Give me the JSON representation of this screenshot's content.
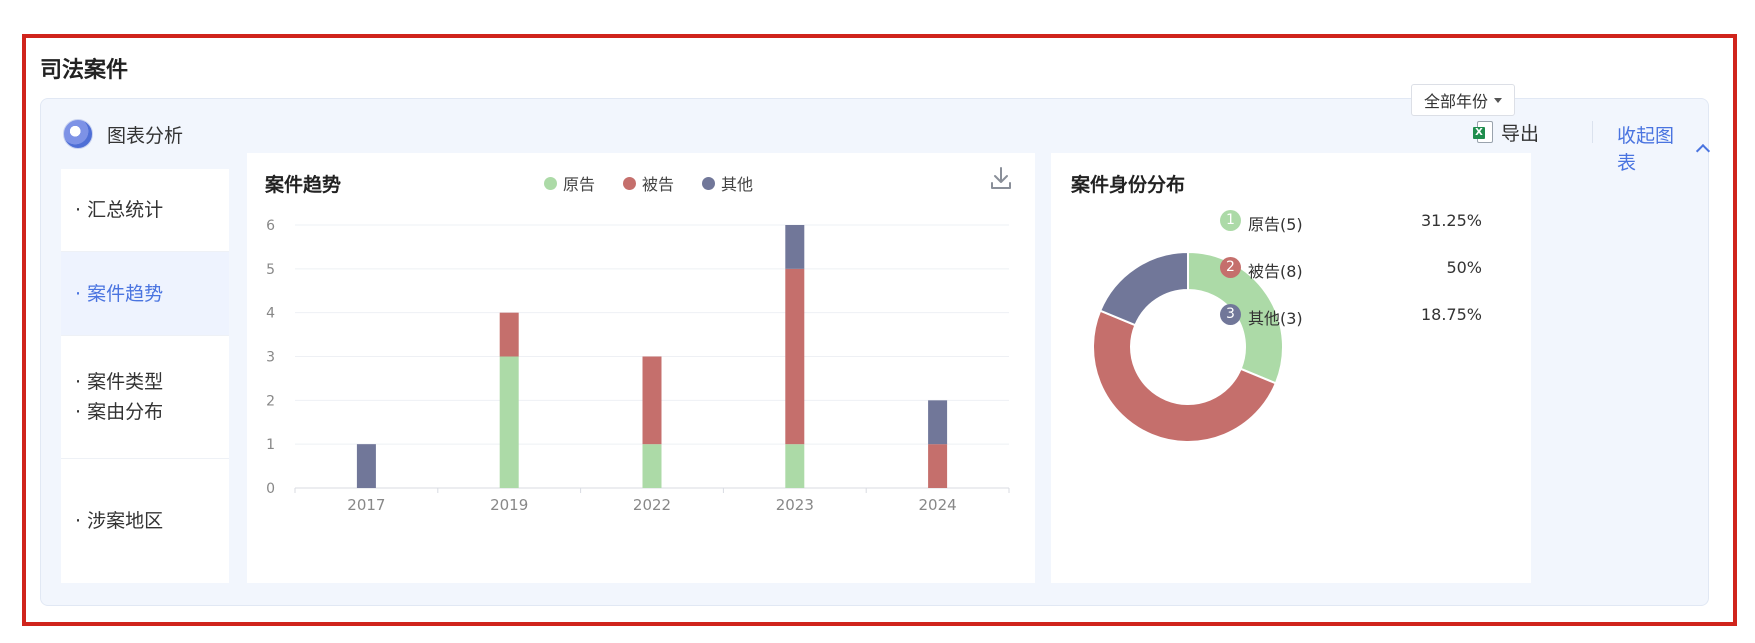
{
  "section_title": "司法案件",
  "panel": {
    "title": "图表分析",
    "export_label": "导出",
    "collapse_label": "收起图表"
  },
  "nav": {
    "items": [
      {
        "label": "· 汇总统计"
      },
      {
        "label": "· 案件趋势"
      },
      {
        "label": "· 案件类型"
      },
      {
        "label": "· 案由分布"
      },
      {
        "label": "· 涉案地区"
      }
    ]
  },
  "colors": {
    "plaintiff": "#acdaa7",
    "defendant": "#c56f6c",
    "other": "#717799",
    "accent": "#4a74e0"
  },
  "icons": {
    "logo": "chart-analysis-logo-icon",
    "export": "excel-icon",
    "collapse": "chevron-up-icon",
    "download": "download-icon",
    "select": "caret-down-icon"
  },
  "trend_card": {
    "title": "案件趋势"
  },
  "pie_card": {
    "title": "案件身份分布",
    "year_select": "全部年份",
    "legend": [
      {
        "index": "1",
        "label": "原告(5)",
        "percent": "31.25%"
      },
      {
        "index": "2",
        "label": "被告(8)",
        "percent": "50%"
      },
      {
        "index": "3",
        "label": "其他(3)",
        "percent": "18.75%"
      }
    ]
  },
  "chart_data": [
    {
      "type": "bar",
      "stacked": true,
      "title": "案件趋势",
      "categories": [
        "2017",
        "2019",
        "2022",
        "2023",
        "2024"
      ],
      "series": [
        {
          "name": "原告",
          "values": [
            0,
            3,
            1,
            1,
            0
          ]
        },
        {
          "name": "被告",
          "values": [
            0,
            1,
            2,
            4,
            1
          ]
        },
        {
          "name": "其他",
          "values": [
            1,
            0,
            0,
            1,
            1
          ]
        }
      ],
      "ylim": [
        0,
        6
      ],
      "yticks": [
        "0",
        "1",
        "2",
        "3",
        "4",
        "5",
        "6"
      ],
      "grid": true,
      "legend_position": "top"
    },
    {
      "type": "pie",
      "donut": true,
      "title": "案件身份分布",
      "labels": [
        "原告",
        "被告",
        "其他"
      ],
      "values": [
        5,
        8,
        3
      ],
      "legend_position": "right"
    }
  ]
}
